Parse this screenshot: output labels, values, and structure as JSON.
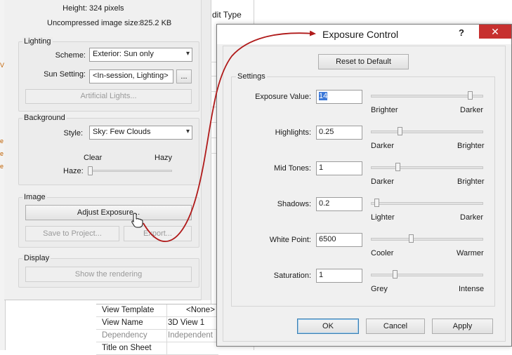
{
  "background_app": {
    "image_info": {
      "height_label": "Height:",
      "height_value": "324 pixels",
      "size_label": "Uncompressed image size:",
      "size_value": "825.2 KB"
    },
    "lighting": {
      "group_label": "Lighting",
      "scheme_label": "Scheme:",
      "scheme_value": "Exterior: Sun only",
      "sun_label": "Sun Setting:",
      "sun_value": "<In-session, Lighting>",
      "sun_browse_label": "...",
      "artificial_lights_label": "Artificial Lights..."
    },
    "background": {
      "group_label": "Background",
      "style_label": "Style:",
      "style_value": "Sky: Few Clouds",
      "clear_label": "Clear",
      "hazy_label": "Hazy",
      "haze_label": "Haze:",
      "haze_level": 0
    },
    "image": {
      "group_label": "Image",
      "adjust_exposure_label": "Adjust Exposure...",
      "save_to_project_label": "Save to Project...",
      "export_label": "Export..."
    },
    "display": {
      "group_label": "Display",
      "show_rendering_label": "Show the rendering"
    },
    "header_snippet": "dit Type",
    "properties": [
      {
        "key": "View Template",
        "value": "<None>"
      },
      {
        "key": "View Name",
        "value": "3D View 1"
      },
      {
        "key": "Dependency",
        "value": "Independent"
      },
      {
        "key": "Title on Sheet",
        "value": ""
      }
    ]
  },
  "dialog": {
    "title": "Exposure Control",
    "help_label": "?",
    "close_label": "✕",
    "reset_label": "Reset to Default",
    "settings_label": "Settings",
    "rows": [
      {
        "label": "Exposure Value:",
        "value": "14",
        "left_caption": "Brighter",
        "right_caption": "Darker",
        "level": 0.9
      },
      {
        "label": "Highlights:",
        "value": "0.25",
        "left_caption": "Darker",
        "right_caption": "Brighter",
        "level": 0.25
      },
      {
        "label": "Mid Tones:",
        "value": "1",
        "left_caption": "Darker",
        "right_caption": "Brighter",
        "level": 0.23
      },
      {
        "label": "Shadows:",
        "value": "0.2",
        "left_caption": "Lighter",
        "right_caption": "Darker",
        "level": 0.03
      },
      {
        "label": "White Point:",
        "value": "6500",
        "left_caption": "Cooler",
        "right_caption": "Warmer",
        "level": 0.35
      },
      {
        "label": "Saturation:",
        "value": "1",
        "left_caption": "Grey",
        "right_caption": "Intense",
        "level": 0.2
      }
    ],
    "ok_label": "OK",
    "cancel_label": "Cancel",
    "apply_label": "Apply"
  },
  "colors": {
    "annotation_arrow": "#b01a1a",
    "close_button": "#c7302f",
    "selection": "#3b78d8"
  },
  "icons": [
    "pointer-hand-icon",
    "chevron-down-icon",
    "close-icon",
    "help-icon"
  ]
}
